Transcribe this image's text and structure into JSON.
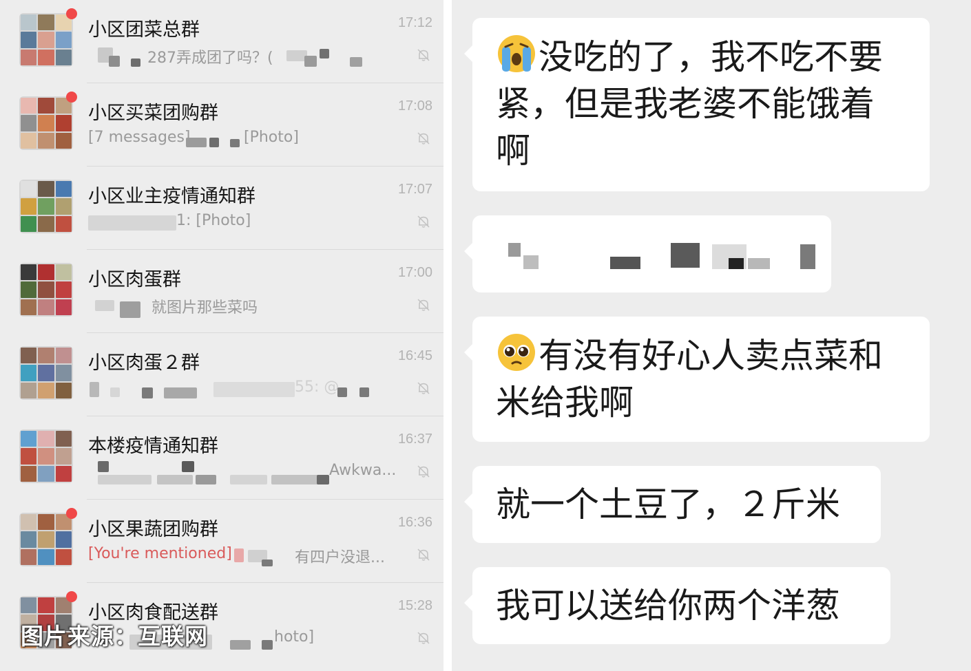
{
  "chat_list": [
    {
      "name": "小区团菜总群",
      "time": "17:12",
      "preview": "287弄成团了吗？(",
      "mention": "",
      "unread": true,
      "avatar_colors": [
        "#b9c6cc",
        "#8f7a5a",
        "#e7d3b0",
        "#5a7a9a",
        "#d9a090",
        "#7aa0c8",
        "#c87a70",
        "#d07060",
        "#6a8090"
      ]
    },
    {
      "name": "小区买菜团购群",
      "time": "17:08",
      "preview": "[7 messages]",
      "preview2": "[Photo]",
      "mention": "",
      "unread": true,
      "avatar_colors": [
        "#e8b8b0",
        "#a04a3a",
        "#c0a080",
        "#909090",
        "#d08050",
        "#b04030",
        "#e0c0a0",
        "#c09070",
        "#a06040"
      ]
    },
    {
      "name": "小区业主疫情通知群",
      "time": "17:07",
      "preview": "1: [Photo]",
      "mention": "",
      "unread": false,
      "avatar_colors": [
        "#e0e0e0",
        "#6a5a4a",
        "#4a7ab0",
        "#d0a040",
        "#70a060",
        "#b0a070",
        "#409050",
        "#8a6a4a",
        "#c05040"
      ]
    },
    {
      "name": "小区肉蛋群",
      "time": "17:00",
      "preview": "就图片那些菜吗",
      "mention": "",
      "unread": false,
      "avatar_colors": [
        "#3a3a3a",
        "#b03030",
        "#c0c0a0",
        "#506a3a",
        "#905040",
        "#c04040",
        "#a07050",
        "#c08080",
        "#c04050"
      ]
    },
    {
      "name": "小区肉蛋２群",
      "time": "16:45",
      "preview": "55: @",
      "mention": "",
      "unread": false,
      "avatar_colors": [
        "#806050",
        "#b08070",
        "#c09090",
        "#40a0c0",
        "#6070a0",
        "#8090a0",
        "#b0a090",
        "#d0a070",
        "#806040"
      ]
    },
    {
      "name": "本楼疫情通知群",
      "time": "16:37",
      "preview": "Awkwa...",
      "mention": "",
      "unread": false,
      "avatar_colors": [
        "#60a0d0",
        "#e0b0b0",
        "#806050",
        "#c05040",
        "#d09080",
        "#c0a090",
        "#a06040",
        "#80a0c0",
        "#c04040"
      ]
    },
    {
      "name": "小区果蔬团购群",
      "time": "16:36",
      "preview": "有四户没退...",
      "mention": "[You're mentioned]",
      "unread": true,
      "avatar_colors": [
        "#d0c0b0",
        "#a06040",
        "#c09070",
        "#6a8aa0",
        "#c0a070",
        "#5070a0",
        "#b07060",
        "#5090c0",
        "#c05040"
      ]
    },
    {
      "name": "小区肉食配送群",
      "time": "15:28",
      "preview": "hoto]",
      "mention": "",
      "unread": true,
      "avatar_colors": [
        "#8090a0",
        "#c04040",
        "#a08070",
        "#c0b0a0",
        "#b04040",
        "#707070",
        "#d09060",
        "#a0a0a0",
        "#806050"
      ]
    }
  ],
  "watermark": "图片来源：互联网",
  "messages": [
    {
      "emoji": "crying-face",
      "text": "没吃的了，我不吃不要紧，但是我老婆不能饿着啊"
    },
    {
      "emoji": "",
      "text": ""
    },
    {
      "emoji": "pleading-face",
      "text": "有没有好心人卖点菜和米给我啊"
    },
    {
      "emoji": "",
      "text": "就一个土豆了，２斤米"
    },
    {
      "emoji": "",
      "text": "我可以送给你两个洋葱"
    }
  ],
  "colors": {
    "unread_dot": "#f04848",
    "mention": "#d95a5a",
    "list_bg": "#ededed",
    "bubble_bg": "#ffffff"
  }
}
